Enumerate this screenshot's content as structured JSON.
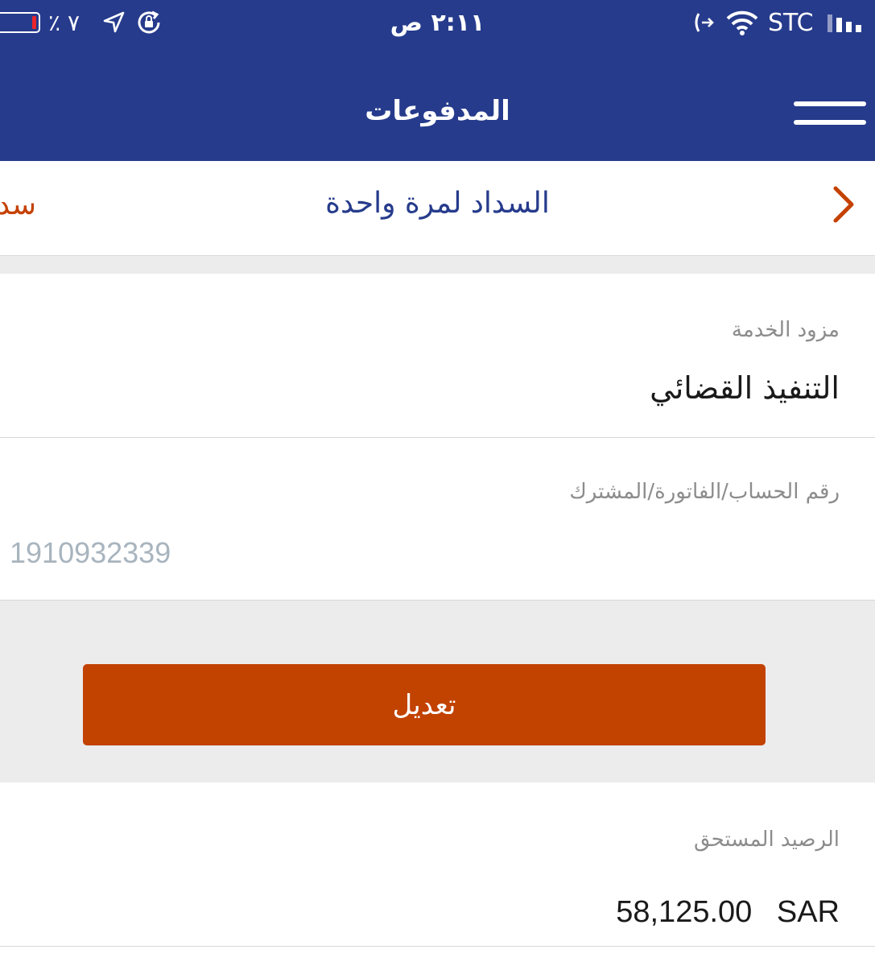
{
  "status_bar": {
    "battery_percent": "٪ ٧",
    "time": "٢:١١ ص",
    "carrier": "STC",
    "icons": [
      "battery-icon",
      "location-arrow-icon",
      "rotation-lock-icon",
      "call-forward-icon",
      "wifi-icon",
      "signal-icon"
    ]
  },
  "header": {
    "title": "المدفوعات",
    "menu_icon": "hamburger-icon"
  },
  "tabs": {
    "active_label": "السداد لمرة واحدة",
    "next_label": "سداد",
    "next_icon": "chevron-right-icon"
  },
  "form": {
    "provider_label": "مزود الخدمة",
    "provider_value": "التنفيذ القضائي",
    "account_label": "رقم الحساب/الفاتورة/المشترك",
    "account_placeholder": "1910932339",
    "edit_button": "تعديل",
    "balance_label": "الرصيد المستحق",
    "balance_amount": "58,125.00",
    "balance_currency": "SAR"
  },
  "colors": {
    "header_bg": "#263b8c",
    "accent_orange": "#c24200",
    "tab_active_text": "#263b8c"
  }
}
